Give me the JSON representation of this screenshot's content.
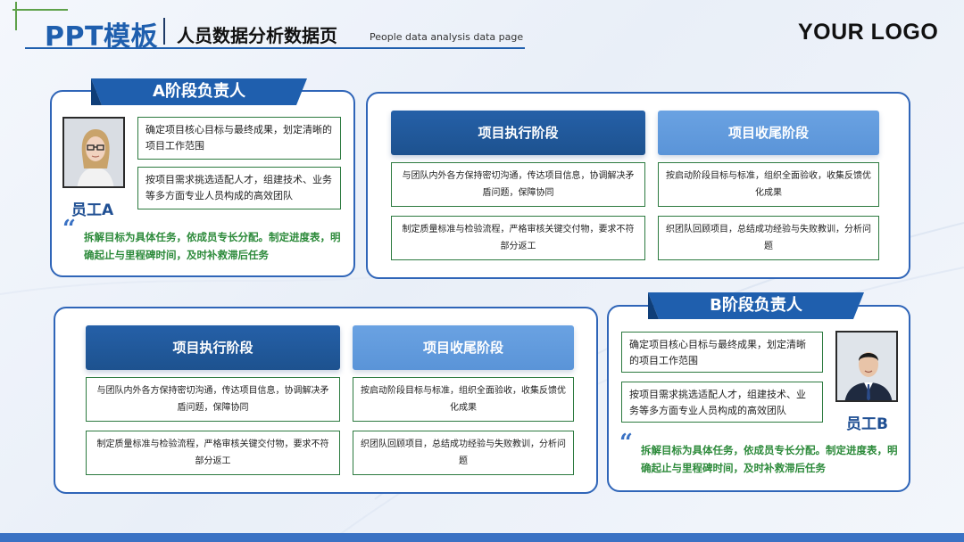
{
  "header": {
    "title": "PPT模板",
    "subtitle": "人员数据分析数据页",
    "english": "People data analysis data page",
    "logo": "YOUR LOGO"
  },
  "colors": {
    "primary": "#1f5fae",
    "accent_light": "#5a94d8",
    "green": "#2c8a3a",
    "corner": "#5ea14a"
  },
  "section_a": {
    "ribbon": "A阶段负责人",
    "employee": "员工A",
    "photo_icon": "woman-portrait-photo",
    "tasks": [
      "确定项目核心目标与最终成果，划定清晰的项目工作范围",
      "按项目需求挑选适配人才，组建技术、业务等多方面专业人员构成的高效团队"
    ],
    "quote_mark": "“",
    "quote": "拆解目标为具体任务，依成员专长分配。制定进度表，明确起止与里程碑时间，及时补救滞后任务"
  },
  "section_b": {
    "ribbon": "B阶段负责人",
    "employee": "员工B",
    "photo_icon": "man-portrait-photo",
    "tasks": [
      "确定项目核心目标与最终成果，划定清晰的项目工作范围",
      "按项目需求挑选适配人才，组建技术、业务等多方面专业人员构成的高效团队"
    ],
    "quote_mark": "“",
    "quote": "拆解目标为具体任务，依成员专长分配。制定进度表，明确起止与里程碑时间，及时补救滞后任务"
  },
  "phases_top": {
    "exec_title": "项目执行阶段",
    "close_title": "项目收尾阶段",
    "exec_items": [
      "与团队内外各方保持密切沟通，传达项目信息，协调解决矛盾问题，保障协同",
      "制定质量标准与检验流程，严格审核关键交付物，要求不符部分返工"
    ],
    "close_items": [
      "按启动阶段目标与标准，组织全面验收，收集反馈优化成果",
      "织团队回顾项目，总结成功经验与失败教训，分析问题"
    ]
  },
  "phases_bottom": {
    "exec_title": "项目执行阶段",
    "close_title": "项目收尾阶段",
    "exec_items": [
      "与团队内外各方保持密切沟通，传达项目信息，协调解决矛盾问题，保障协同",
      "制定质量标准与检验流程，严格审核关键交付物，要求不符部分返工"
    ],
    "close_items": [
      "按启动阶段目标与标准，组织全面验收，收集反馈优化成果",
      "织团队回顾项目，总结成功经验与失败教训，分析问题"
    ]
  }
}
